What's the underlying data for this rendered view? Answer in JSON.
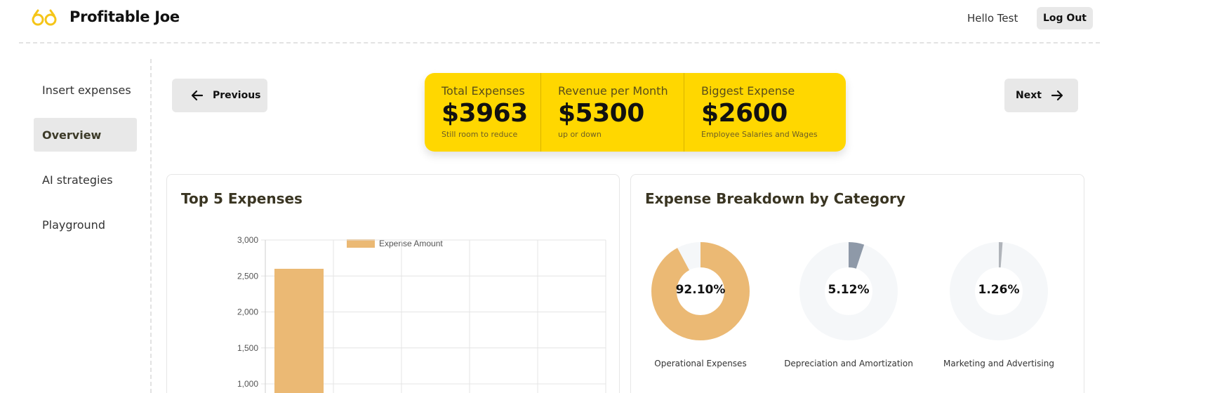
{
  "header": {
    "brand": "Profitable Joe",
    "greeting": "Hello Test",
    "logout_label": "Log Out",
    "logo_icon": "glasses-icon",
    "brand_color": "#f5c518"
  },
  "sidebar": {
    "items": [
      {
        "label": "Insert expenses",
        "active": false
      },
      {
        "label": "Overview",
        "active": true
      },
      {
        "label": "AI strategies",
        "active": false
      },
      {
        "label": "Playground",
        "active": false
      }
    ]
  },
  "navigation": {
    "previous_label": "Previous",
    "next_label": "Next"
  },
  "stats": [
    {
      "title": "Total Expenses",
      "value": "$3963",
      "desc": "Still room to reduce"
    },
    {
      "title": "Revenue per Month",
      "value": "$5300",
      "desc": "up or down"
    },
    {
      "title": "Biggest Expense",
      "value": "$2600",
      "desc": "Employee Salaries and Wages"
    }
  ],
  "stats_color": "#ffd700",
  "top_expenses_card": {
    "title": "Top 5 Expenses"
  },
  "breakdown_card": {
    "title": "Expense Breakdown by Category"
  },
  "chart_data": [
    {
      "type": "bar",
      "title": "Top 5 Expenses",
      "legend": [
        "Expense Amount"
      ],
      "legend_position": "top-center",
      "series": [
        {
          "name": "Expense Amount",
          "color": "#ebb974",
          "values": [
            2600
          ]
        }
      ],
      "categories": [
        ""
      ],
      "y_ticks": [
        "3,000",
        "2,500",
        "2,000",
        "1,500",
        "1,000"
      ],
      "ylim_visible": [
        1000,
        3000
      ],
      "grid": true
    },
    {
      "type": "pie",
      "title": "Expense Breakdown by Category",
      "donuts": [
        {
          "label": "92.10%",
          "percent": 92.1,
          "caption": "Operational Expenses",
          "color": "#ebb974"
        },
        {
          "label": "5.12%",
          "percent": 5.12,
          "caption": "Depreciation and Amortization",
          "color": "#8e99a8"
        },
        {
          "label": "1.26%",
          "percent": 1.26,
          "caption": "Marketing and Advertising",
          "color": "#b0b4ba"
        }
      ],
      "track_color": "#f5f7f9"
    }
  ]
}
